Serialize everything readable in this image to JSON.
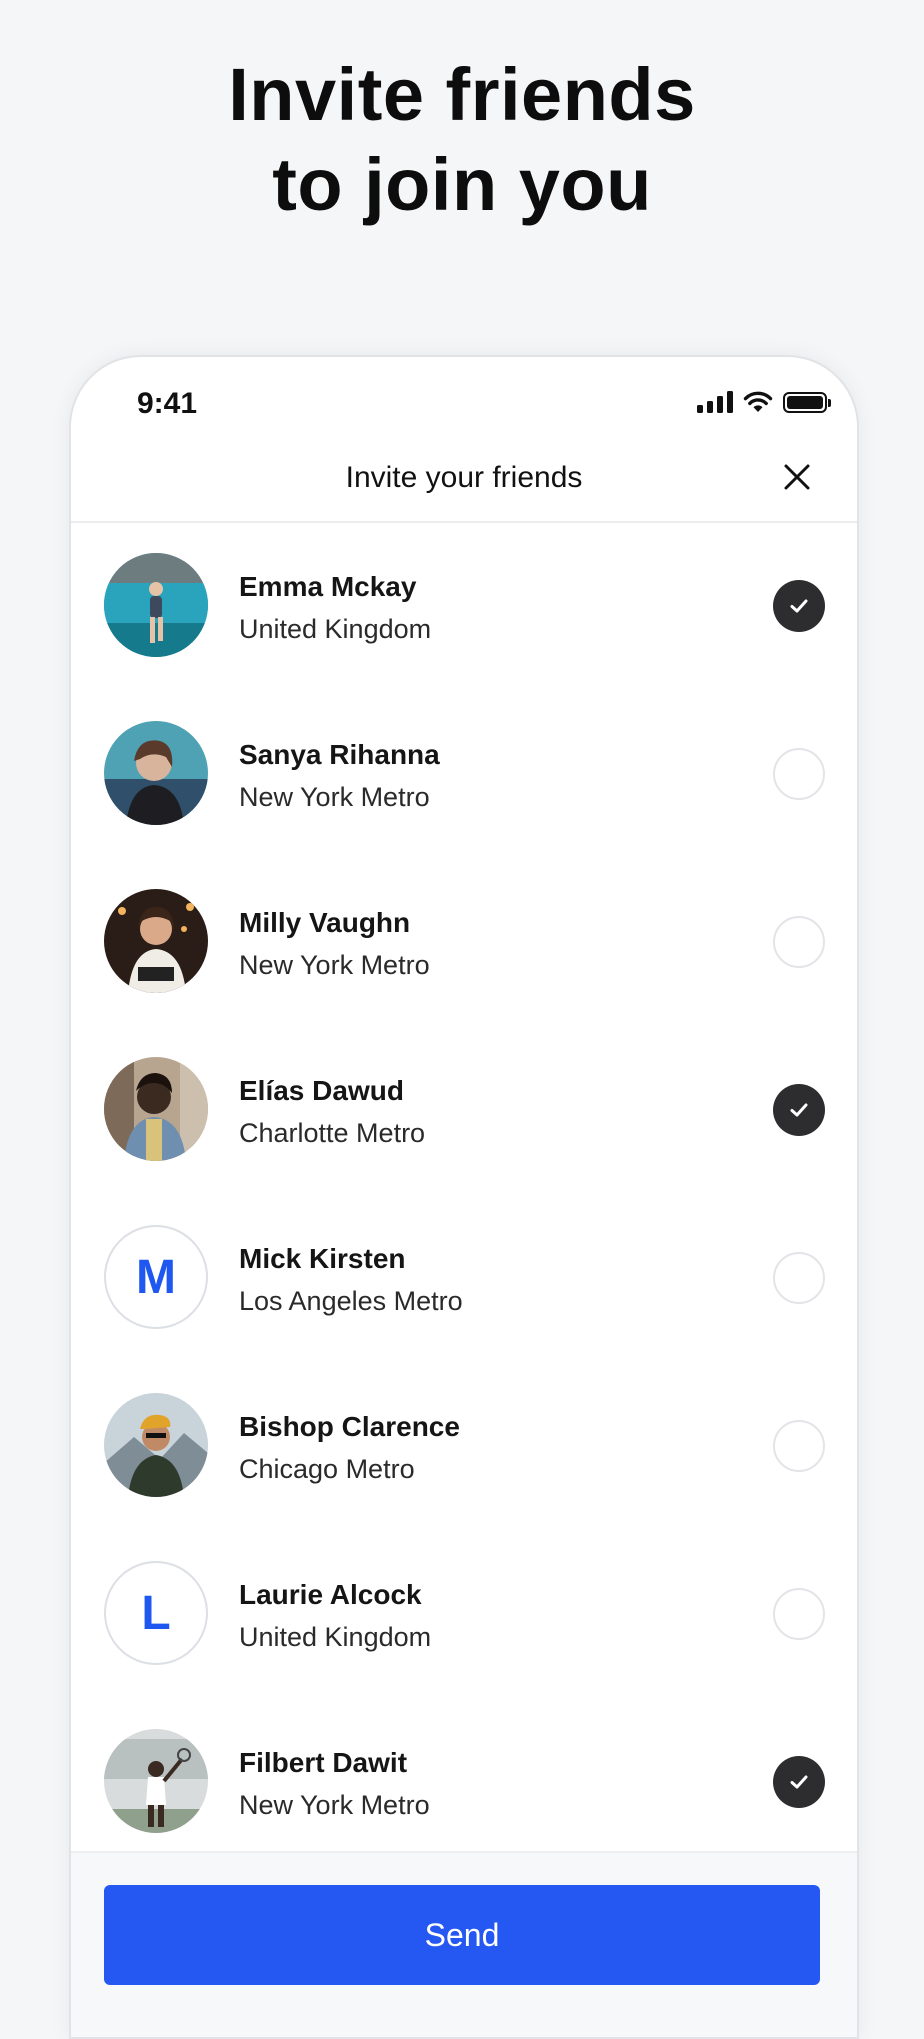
{
  "hero": {
    "title_line1": "Invite friends",
    "title_line2": "to join you"
  },
  "status_bar": {
    "time": "9:41"
  },
  "header": {
    "title": "Invite your friends",
    "close_icon": "close-icon"
  },
  "friends": [
    {
      "name": "Emma Mckay",
      "location": "United Kingdom",
      "selected": true,
      "avatar": "photo"
    },
    {
      "name": "Sanya Rihanna",
      "location": "New York Metro",
      "selected": false,
      "avatar": "photo"
    },
    {
      "name": "Milly Vaughn",
      "location": "New York Metro",
      "selected": false,
      "avatar": "photo"
    },
    {
      "name": "Elías Dawud",
      "location": "Charlotte Metro",
      "selected": true,
      "avatar": "photo"
    },
    {
      "name": "Mick Kirsten",
      "location": "Los Angeles Metro",
      "selected": false,
      "avatar": "letter",
      "initial": "M"
    },
    {
      "name": "Bishop Clarence",
      "location": "Chicago Metro",
      "selected": false,
      "avatar": "photo"
    },
    {
      "name": "Laurie Alcock",
      "location": "United Kingdom",
      "selected": false,
      "avatar": "letter",
      "initial": "L"
    },
    {
      "name": "Filbert Dawit",
      "location": "New York Metro",
      "selected": true,
      "avatar": "photo"
    }
  ],
  "footer": {
    "send_label": "Send"
  },
  "colors": {
    "accent": "#2557f2",
    "initial_letter": "#1e58f0",
    "check_on": "#2d2d2f",
    "page_background": "#f5f6f8"
  }
}
